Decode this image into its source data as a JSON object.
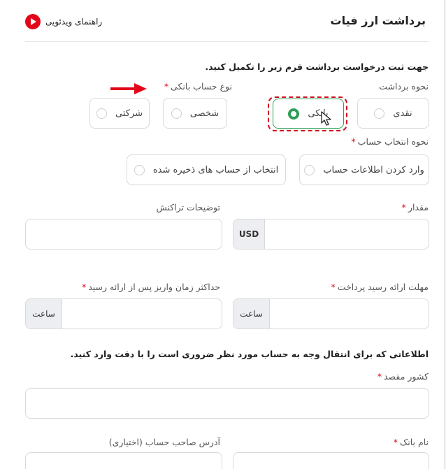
{
  "header": {
    "title": "برداشت ارز فیات",
    "help_link": "راهنمای ویدئویی"
  },
  "intro": "جهت ثبت درخواست برداشت فرم زیر را تکمیل کنید.",
  "withdraw_method": {
    "label": "نحوه برداشت",
    "options": [
      {
        "label": "نقدی",
        "selected": false
      },
      {
        "label": "بانکی",
        "selected": true
      }
    ]
  },
  "account_type": {
    "label": "نوع حساب بانکی",
    "required_mark": "*",
    "options": [
      {
        "label": "شخصی",
        "selected": false
      },
      {
        "label": "شرکتی",
        "selected": false
      }
    ]
  },
  "account_selection": {
    "label": "نحوه انتخاب حساب",
    "required_mark": "*",
    "options": [
      {
        "label": "وارد کردن اطلاعات حساب",
        "selected": false
      },
      {
        "label": "انتخاب از حساب های ذخیره شده",
        "selected": false
      }
    ]
  },
  "amount": {
    "label": "مقدار",
    "required_mark": "*",
    "currency": "USD",
    "value": ""
  },
  "description": {
    "label": "توضیحات تراکنش",
    "value": ""
  },
  "receipt_deadline": {
    "label": "مهلت ارائه رسید پرداخت",
    "required_mark": "*",
    "unit": "ساعت",
    "value": ""
  },
  "max_deposit_time": {
    "label": "حداکثر زمان واریز پس از ارائه رسید",
    "required_mark": "*",
    "unit": "ساعت",
    "value": ""
  },
  "transfer_note": "اطلاعاتی که برای انتقال وجه به حساب مورد نظر ضروری است را با دقت وارد کنید.",
  "destination_country": {
    "label": "کشور مقصد",
    "required_mark": "*",
    "value": ""
  },
  "bank_name": {
    "label": "نام بانک",
    "required_mark": "*",
    "value": ""
  },
  "holder_address": {
    "label": "آدرس صاحب حساب (اختیاری)",
    "value": ""
  },
  "colors": {
    "accent_green": "#2e9e56",
    "required_red": "#e3061a",
    "annotation_red": "#d10f1e"
  },
  "icons": {
    "help": "play-icon",
    "annotation": "red-arrow-icon",
    "pointer": "mouse-cursor-icon"
  }
}
